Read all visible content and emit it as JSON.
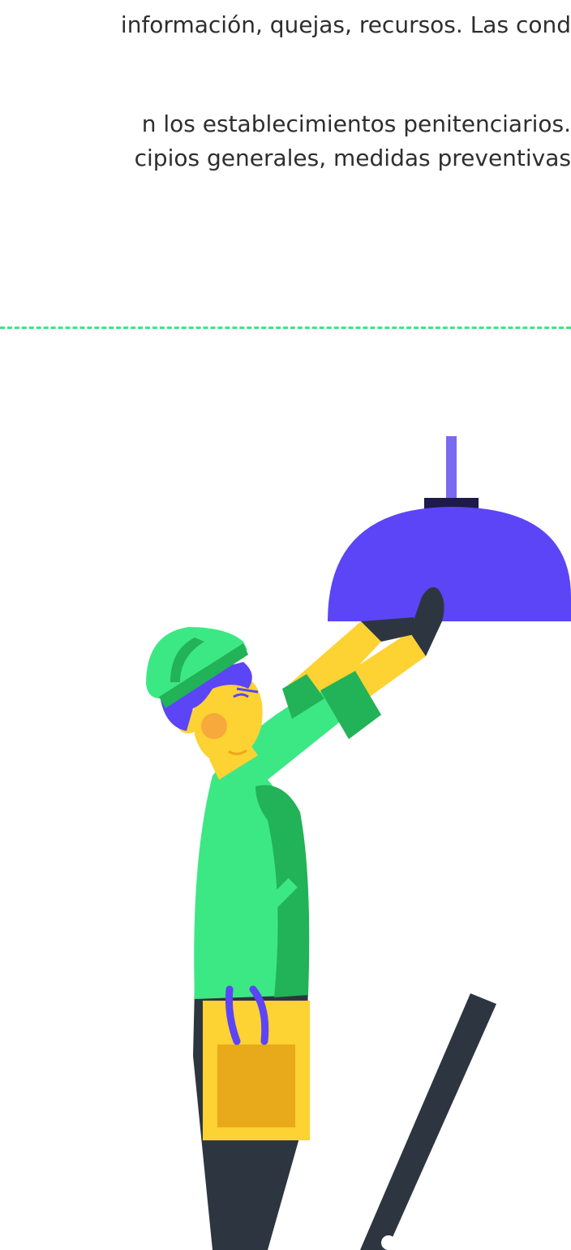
{
  "body_text": {
    "line1": "información, quejas, recursos. Las cond",
    "line2": "n los establecimientos penitenciarios.",
    "line3": "cipios generales, medidas preventivas"
  },
  "colors": {
    "divider": "#3ce884",
    "lamp_shade": "#5b45f6",
    "lamp_rod": "#7a6af0",
    "shirt": "#3ce884",
    "shirt_shadow": "#22b257",
    "skin": "#fdd233",
    "tool_bag": "#fdd233",
    "tool_bag_pocket": "#e8a91a",
    "pants": "#2d3640",
    "hair": "#5b45f6",
    "cheek": "#f7a93c"
  },
  "illustration": {
    "subject": "worker-fixing-lamp"
  }
}
